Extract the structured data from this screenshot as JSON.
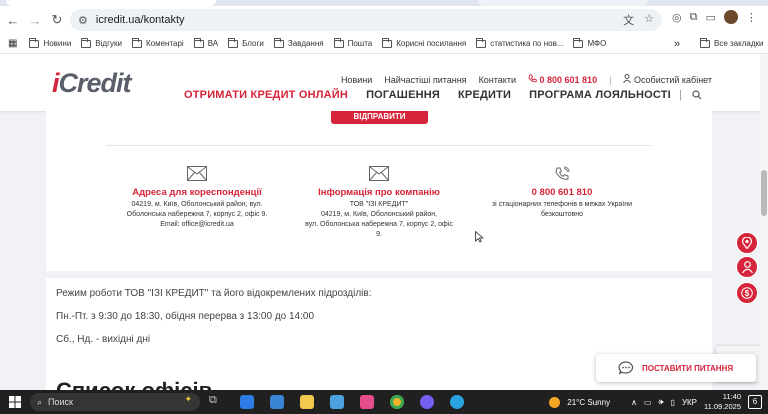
{
  "browser": {
    "url": "icredit.ua/kontakty",
    "bookmarks": [
      "Новини",
      "Відгуки",
      "Коментарі",
      "ВА",
      "Блоги",
      "Завдання",
      "Пошта",
      "Корисні посилання",
      "статистика по нов...",
      "МФО"
    ],
    "all_bookmarks": "Все закладки",
    "more": "»"
  },
  "site": {
    "logo": "iCredit",
    "topnav": [
      "Новини",
      "Найчастіші питання",
      "Контакти"
    ],
    "phone": "0 800 601 810",
    "cabinet": "Особистий кабінет",
    "mainnav": [
      "ОТРИМАТИ КРЕДИТ ОНЛАЙН",
      "ПОГАШЕННЯ",
      "КРЕДИТИ",
      "ПРОГРАМА ЛОЯЛЬНОСТІ"
    ],
    "nav_sep": "|"
  },
  "contacts": {
    "send_button": "ВІДПРАВИТИ",
    "columns": [
      {
        "title": "Адреса для кореспонденції",
        "lines": [
          "04219, м. Київ, Оболонський район, вул.",
          "Оболонська набережна 7, корпус 2, офіс 9.",
          "Email: office@icredit.ua"
        ]
      },
      {
        "title": "Інформація про компанію",
        "lines": [
          "ТОВ \"ІЗІ КРЕДИТ\"",
          "04219, м. Київ, Оболонський район,",
          "вул. Оболонська набережна 7, корпус 2, офіс",
          "9."
        ]
      },
      {
        "title": "0 800 601 810",
        "lines": [
          "зі стаціонарних телефонів в межах України",
          "безкоштовно"
        ]
      }
    ]
  },
  "schedule": {
    "intro": "Режим роботи ТОВ \"ІЗІ КРЕДИТ\" та його відокремлених підрозділів:",
    "weekdays": "Пн.-Пт. з 9:30 до 18:30, обідня перерва з 13:00 до 14:00",
    "weekend": "Сб., Нд. - вихідні дні",
    "next_heading": "Список офісів"
  },
  "widgets": {
    "chat_button": "ПОСТАВИТИ ПИТАННЯ"
  },
  "taskbar": {
    "search": "Поиск",
    "weather": "21°C  Sunny",
    "lang": "УКР",
    "time": "11:40",
    "date": "11.09.2025",
    "notifications": "6"
  },
  "colors": {
    "brand_red": "#d6243a",
    "logo_gray": "#5a5f6b"
  }
}
